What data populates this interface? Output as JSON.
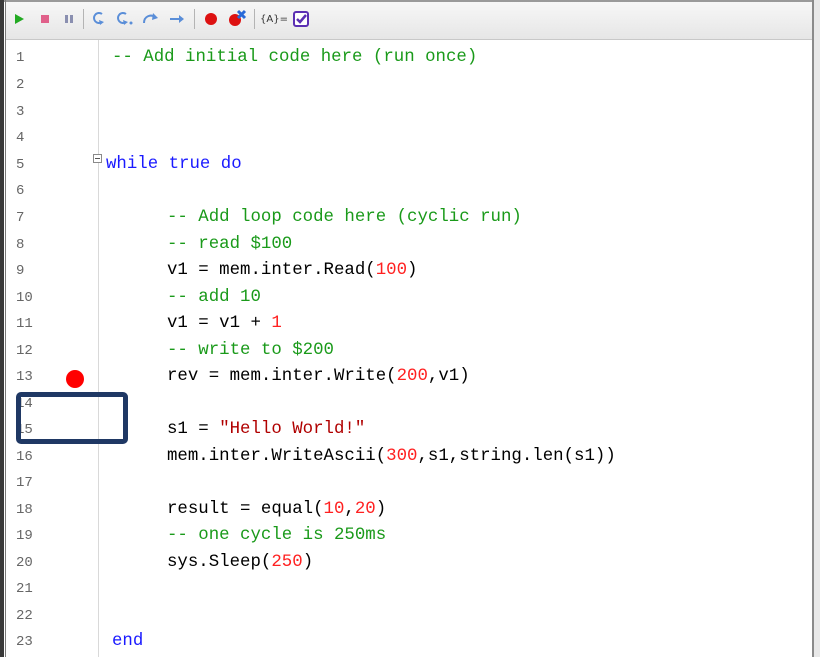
{
  "toolbar": {
    "buttons": [
      {
        "name": "run-icon",
        "label": "run"
      },
      {
        "name": "stop-icon",
        "label": "stop"
      },
      {
        "name": "pause-icon",
        "label": "pause"
      },
      {
        "name": "step-into-icon",
        "label": "step into"
      },
      {
        "name": "step-over-icon",
        "label": "step over"
      },
      {
        "name": "step-out-icon",
        "label": "step out"
      },
      {
        "name": "run-to-cursor-icon",
        "label": "run to cursor"
      },
      {
        "name": "toggle-breakpoint-icon",
        "label": "toggle breakpoint"
      },
      {
        "name": "clear-breakpoints-icon",
        "label": "clear breakpoints"
      },
      {
        "name": "watch-variables-icon",
        "label": "{A}="
      },
      {
        "name": "check-syntax-icon",
        "label": "check"
      }
    ],
    "watch_label": "{A}="
  },
  "editor": {
    "line_numbers": [
      "1",
      "2",
      "3",
      "4",
      "5",
      "6",
      "7",
      "8",
      "9",
      "10",
      "11",
      "12",
      "13",
      "14",
      "15",
      "16",
      "17",
      "18",
      "19",
      "20",
      "21",
      "22",
      "23"
    ],
    "lines": {
      "l1": "-- Add initial code here (run once)",
      "l5_kw": "while true do",
      "l7": "-- Add loop code here (cyclic run)",
      "l8": "-- read $100",
      "l9_a": "v1 = mem.inter.Read(",
      "l9_n": "100",
      "l9_b": ")",
      "l10": "-- add 10",
      "l11_a": "v1 = v1 + ",
      "l11_n": "1",
      "l12": "-- write to $200",
      "l13_a": "rev = mem.inter.Write(",
      "l13_n": "200",
      "l13_b": ",v1)",
      "l15_a": "s1 = ",
      "l15_s": "\"Hello World!\"",
      "l16_a": "mem.inter.WriteAscii(",
      "l16_n": "300",
      "l16_b": ",s1,string.len(s1))",
      "l18_a": "result = equal(",
      "l18_n1": "10",
      "l18_c": ",",
      "l18_n2": "20",
      "l18_b": ")",
      "l19": "-- one cycle is 250ms",
      "l20_a": "sys.Sleep(",
      "l20_n": "250",
      "l20_b": ")",
      "l23_kw": "end"
    },
    "breakpoint_line": "13",
    "colors": {
      "comment": "#1a9a1a",
      "keyword": "#1a1aff",
      "number": "#ff2020",
      "string": "#b00000",
      "breakpoint": "#ff0000",
      "highlight_box": "#1f3864"
    }
  }
}
